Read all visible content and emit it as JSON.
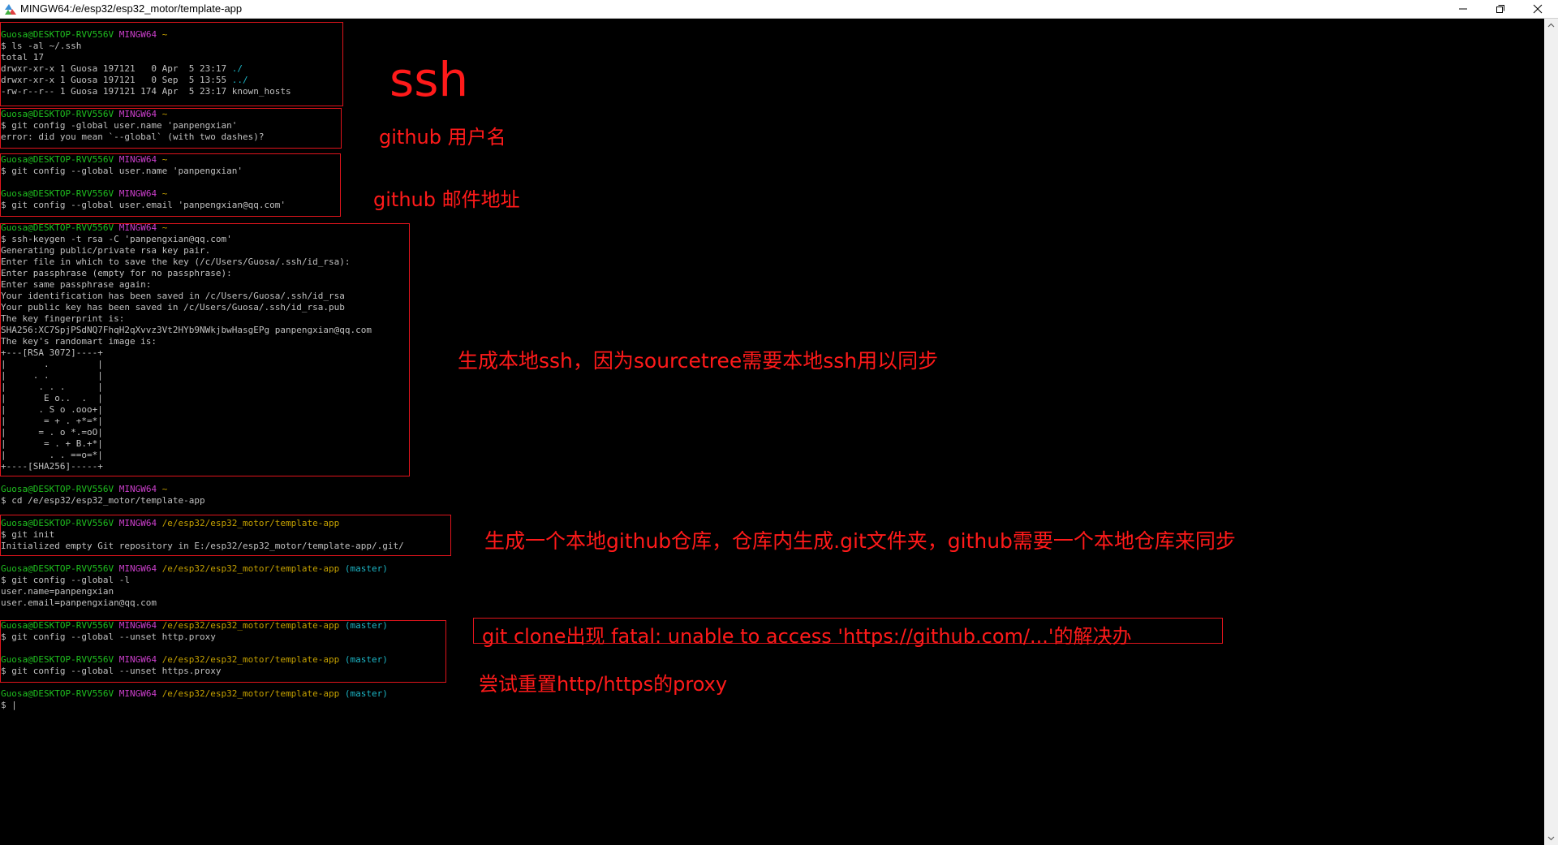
{
  "window": {
    "title": "MINGW64:/e/esp32/esp32_motor/template-app",
    "buttons": {
      "minimize": "minimize-icon",
      "maximize": "restore-icon",
      "close": "close-icon"
    }
  },
  "colors": {
    "background": "#000000",
    "text": "#c0c0c0",
    "user_host": "#1fbf1f",
    "mingw": "#cc3fcc",
    "path": "#c4a000",
    "branch": "#1cb6c6",
    "annotation": "#ff1a1a"
  },
  "terminal": {
    "lines": [
      {
        "segments": [
          {
            "text": "Guosa@DESKTOP-RVV556V",
            "color": "g"
          },
          {
            "text": " "
          },
          {
            "text": "MINGW64",
            "color": "m"
          },
          {
            "text": " "
          },
          {
            "text": "~",
            "color": "y"
          }
        ]
      },
      {
        "segments": [
          {
            "text": "$ ls -al ~/.ssh"
          }
        ]
      },
      {
        "segments": [
          {
            "text": "total 17"
          }
        ]
      },
      {
        "segments": [
          {
            "text": "drwxr-xr-x 1 Guosa 197121   0 Apr  5 23:17 "
          },
          {
            "text": "./",
            "color": "c"
          }
        ]
      },
      {
        "segments": [
          {
            "text": "drwxr-xr-x 1 Guosa 197121   0 Sep  5 13:55 "
          },
          {
            "text": "../",
            "color": "c"
          }
        ]
      },
      {
        "segments": [
          {
            "text": "-rw-r--r-- 1 Guosa 197121 174 Apr  5 23:17 known_hosts"
          }
        ]
      },
      {
        "segments": [
          {
            "text": ""
          }
        ]
      },
      {
        "segments": [
          {
            "text": "Guosa@DESKTOP-RVV556V",
            "color": "g"
          },
          {
            "text": " "
          },
          {
            "text": "MINGW64",
            "color": "m"
          },
          {
            "text": " "
          },
          {
            "text": "~",
            "color": "y"
          }
        ]
      },
      {
        "segments": [
          {
            "text": "$ git config -global user.name 'panpengxian'"
          }
        ]
      },
      {
        "segments": [
          {
            "text": "error: did you mean `--global` (with two dashes)?"
          }
        ]
      },
      {
        "segments": [
          {
            "text": ""
          }
        ]
      },
      {
        "segments": [
          {
            "text": "Guosa@DESKTOP-RVV556V",
            "color": "g"
          },
          {
            "text": " "
          },
          {
            "text": "MINGW64",
            "color": "m"
          },
          {
            "text": " "
          },
          {
            "text": "~",
            "color": "y"
          }
        ]
      },
      {
        "segments": [
          {
            "text": "$ git config --global user.name 'panpengxian'"
          }
        ]
      },
      {
        "segments": [
          {
            "text": ""
          }
        ]
      },
      {
        "segments": [
          {
            "text": "Guosa@DESKTOP-RVV556V",
            "color": "g"
          },
          {
            "text": " "
          },
          {
            "text": "MINGW64",
            "color": "m"
          },
          {
            "text": " "
          },
          {
            "text": "~",
            "color": "y"
          }
        ]
      },
      {
        "segments": [
          {
            "text": "$ git config --global user.email 'panpengxian@qq.com'"
          }
        ]
      },
      {
        "segments": [
          {
            "text": ""
          }
        ]
      },
      {
        "segments": [
          {
            "text": "Guosa@DESKTOP-RVV556V",
            "color": "g"
          },
          {
            "text": " "
          },
          {
            "text": "MINGW64",
            "color": "m"
          },
          {
            "text": " "
          },
          {
            "text": "~",
            "color": "y"
          }
        ]
      },
      {
        "segments": [
          {
            "text": "$ ssh-keygen -t rsa -C 'panpengxian@qq.com'"
          }
        ]
      },
      {
        "segments": [
          {
            "text": "Generating public/private rsa key pair."
          }
        ]
      },
      {
        "segments": [
          {
            "text": "Enter file in which to save the key (/c/Users/Guosa/.ssh/id_rsa):"
          }
        ]
      },
      {
        "segments": [
          {
            "text": "Enter passphrase (empty for no passphrase):"
          }
        ]
      },
      {
        "segments": [
          {
            "text": "Enter same passphrase again:"
          }
        ]
      },
      {
        "segments": [
          {
            "text": "Your identification has been saved in /c/Users/Guosa/.ssh/id_rsa"
          }
        ]
      },
      {
        "segments": [
          {
            "text": "Your public key has been saved in /c/Users/Guosa/.ssh/id_rsa.pub"
          }
        ]
      },
      {
        "segments": [
          {
            "text": "The key fingerprint is:"
          }
        ]
      },
      {
        "segments": [
          {
            "text": "SHA256:XC7SpjPSdNQ7FhqH2qXvvz3Vt2HYb9NWkjbwHasgEPg panpengxian@qq.com"
          }
        ]
      },
      {
        "segments": [
          {
            "text": "The key's randomart image is:"
          }
        ]
      },
      {
        "segments": [
          {
            "text": "+---[RSA 3072]----+"
          }
        ]
      },
      {
        "segments": [
          {
            "text": "|       .         |"
          }
        ]
      },
      {
        "segments": [
          {
            "text": "|     . .         |"
          }
        ]
      },
      {
        "segments": [
          {
            "text": "|      . . .      |"
          }
        ]
      },
      {
        "segments": [
          {
            "text": "|       E o..  .  |"
          }
        ]
      },
      {
        "segments": [
          {
            "text": "|      . S o .ooo+|"
          }
        ]
      },
      {
        "segments": [
          {
            "text": "|       = + . +*=*|"
          }
        ]
      },
      {
        "segments": [
          {
            "text": "|      = . o *.=oO|"
          }
        ]
      },
      {
        "segments": [
          {
            "text": "|       = . + B.+*|"
          }
        ]
      },
      {
        "segments": [
          {
            "text": "|        . . ==o=*|"
          }
        ]
      },
      {
        "segments": [
          {
            "text": "+----[SHA256]-----+"
          }
        ]
      },
      {
        "segments": [
          {
            "text": ""
          }
        ]
      },
      {
        "segments": [
          {
            "text": "Guosa@DESKTOP-RVV556V",
            "color": "g"
          },
          {
            "text": " "
          },
          {
            "text": "MINGW64",
            "color": "m"
          },
          {
            "text": " "
          },
          {
            "text": "~",
            "color": "y"
          }
        ]
      },
      {
        "segments": [
          {
            "text": "$ cd /e/esp32/esp32_motor/template-app"
          }
        ]
      },
      {
        "segments": [
          {
            "text": ""
          }
        ]
      },
      {
        "segments": [
          {
            "text": "Guosa@DESKTOP-RVV556V",
            "color": "g"
          },
          {
            "text": " "
          },
          {
            "text": "MINGW64",
            "color": "m"
          },
          {
            "text": " "
          },
          {
            "text": "/e/esp32/esp32_motor/template-app",
            "color": "y"
          }
        ]
      },
      {
        "segments": [
          {
            "text": "$ git init"
          }
        ]
      },
      {
        "segments": [
          {
            "text": "Initialized empty Git repository in E:/esp32/esp32_motor/template-app/.git/"
          }
        ]
      },
      {
        "segments": [
          {
            "text": ""
          }
        ]
      },
      {
        "segments": [
          {
            "text": "Guosa@DESKTOP-RVV556V",
            "color": "g"
          },
          {
            "text": " "
          },
          {
            "text": "MINGW64",
            "color": "m"
          },
          {
            "text": " "
          },
          {
            "text": "/e/esp32/esp32_motor/template-app",
            "color": "y"
          },
          {
            "text": " "
          },
          {
            "text": "(master)",
            "color": "c"
          }
        ]
      },
      {
        "segments": [
          {
            "text": "$ git config --global -l"
          }
        ]
      },
      {
        "segments": [
          {
            "text": "user.name=panpengxian"
          }
        ]
      },
      {
        "segments": [
          {
            "text": "user.email=panpengxian@qq.com"
          }
        ]
      },
      {
        "segments": [
          {
            "text": ""
          }
        ]
      },
      {
        "segments": [
          {
            "text": "Guosa@DESKTOP-RVV556V",
            "color": "g"
          },
          {
            "text": " "
          },
          {
            "text": "MINGW64",
            "color": "m"
          },
          {
            "text": " "
          },
          {
            "text": "/e/esp32/esp32_motor/template-app",
            "color": "y"
          },
          {
            "text": " "
          },
          {
            "text": "(master)",
            "color": "c"
          }
        ]
      },
      {
        "segments": [
          {
            "text": "$ git config --global --unset http.proxy"
          }
        ]
      },
      {
        "segments": [
          {
            "text": ""
          }
        ]
      },
      {
        "segments": [
          {
            "text": "Guosa@DESKTOP-RVV556V",
            "color": "g"
          },
          {
            "text": " "
          },
          {
            "text": "MINGW64",
            "color": "m"
          },
          {
            "text": " "
          },
          {
            "text": "/e/esp32/esp32_motor/template-app",
            "color": "y"
          },
          {
            "text": " "
          },
          {
            "text": "(master)",
            "color": "c"
          }
        ]
      },
      {
        "segments": [
          {
            "text": "$ git config --global --unset https.proxy"
          }
        ]
      },
      {
        "segments": [
          {
            "text": ""
          }
        ]
      },
      {
        "segments": [
          {
            "text": "Guosa@DESKTOP-RVV556V",
            "color": "g"
          },
          {
            "text": " "
          },
          {
            "text": "MINGW64",
            "color": "m"
          },
          {
            "text": " "
          },
          {
            "text": "/e/esp32/esp32_motor/template-app",
            "color": "y"
          },
          {
            "text": " "
          },
          {
            "text": "(master)",
            "color": "c"
          }
        ]
      },
      {
        "segments": [
          {
            "text": "$ |"
          }
        ]
      }
    ]
  },
  "annotations": {
    "ssh": "ssh",
    "username": "github 用户名",
    "email": "github 邮件地址",
    "keygen": "生成本地ssh，因为sourcetree需要本地ssh用以同步",
    "git_init": "生成一个本地github仓库，仓库内生成.git文件夹，github需要一个本地仓库来同步",
    "clone_error": "git clone出现 fatal: unable to access 'https://github.com/...'的解决办",
    "reset_proxy": "尝试重置http/https的proxy"
  }
}
